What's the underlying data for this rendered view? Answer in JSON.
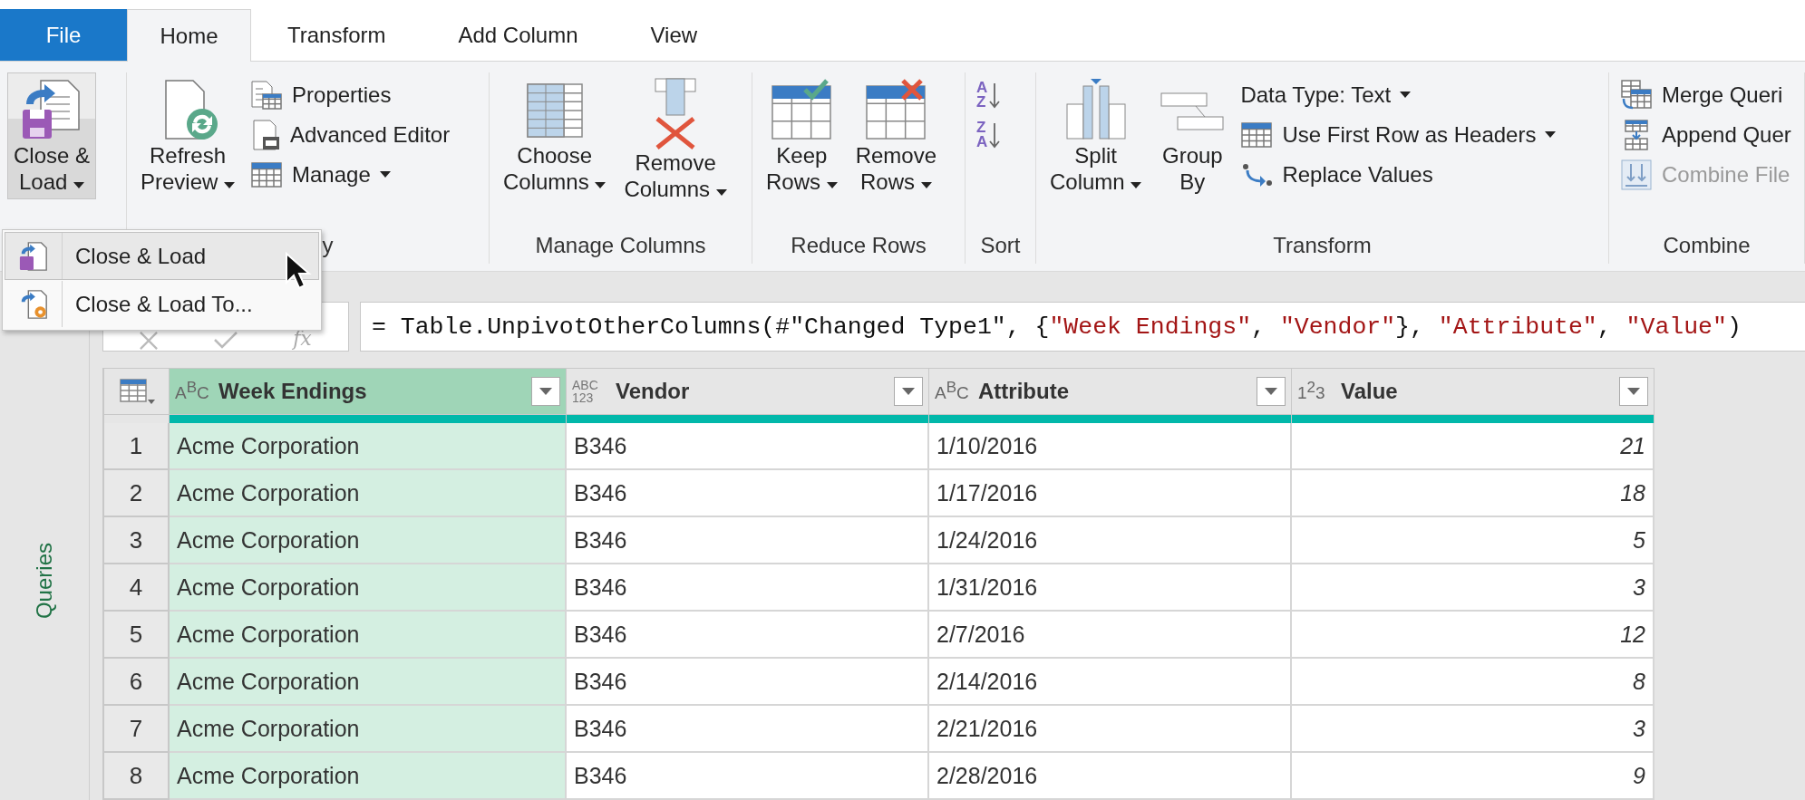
{
  "tabs": [
    {
      "label": "File",
      "kind": "file",
      "selected": false
    },
    {
      "label": "Home",
      "kind": "tab",
      "selected": true
    },
    {
      "label": "Transform",
      "kind": "tab",
      "selected": false
    },
    {
      "label": "Add Column",
      "kind": "tab",
      "selected": false
    },
    {
      "label": "View",
      "kind": "tab",
      "selected": false
    }
  ],
  "ribbon": {
    "groups": [
      {
        "items": [
          {
            "kind": "large",
            "lines": [
              "Close &",
              "Load"
            ],
            "dropdown": true,
            "pressed": true,
            "disabled": false
          }
        ]
      },
      {
        "label": "y",
        "items": [
          {
            "kind": "large",
            "lines": [
              "Refresh",
              "Preview"
            ],
            "dropdown": true,
            "pressed": false,
            "disabled": false
          },
          {
            "kind": "small",
            "label": "Properties",
            "dropdown": false,
            "pressed": false,
            "disabled": false
          },
          {
            "kind": "small",
            "label": "Advanced Editor",
            "dropdown": false,
            "pressed": false,
            "disabled": false
          },
          {
            "kind": "small",
            "label": "Manage",
            "dropdown": true,
            "pressed": false,
            "disabled": false
          }
        ]
      },
      {
        "label": "Manage Columns",
        "items": [
          {
            "kind": "large",
            "lines": [
              "Choose",
              "Columns"
            ],
            "dropdown": true,
            "pressed": false,
            "disabled": false
          },
          {
            "kind": "large",
            "lines": [
              "Remove",
              "Columns"
            ],
            "dropdown": true,
            "pressed": false,
            "disabled": false
          }
        ]
      },
      {
        "label": "Reduce Rows",
        "items": [
          {
            "kind": "large",
            "lines": [
              "Keep",
              "Rows"
            ],
            "dropdown": true,
            "pressed": false,
            "disabled": false
          },
          {
            "kind": "large",
            "lines": [
              "Remove",
              "Rows"
            ],
            "dropdown": true,
            "pressed": false,
            "disabled": false
          }
        ]
      },
      {
        "label": "Sort",
        "items": [
          {
            "kind": "sort",
            "glyph": "AZ",
            "dropdown": false,
            "pressed": false,
            "disabled": false
          },
          {
            "kind": "sort",
            "glyph": "ZA",
            "dropdown": false,
            "pressed": false,
            "disabled": false
          }
        ]
      },
      {
        "label": "Transform",
        "items": [
          {
            "kind": "large",
            "lines": [
              "Split",
              "Column"
            ],
            "dropdown": true,
            "pressed": false,
            "disabled": false
          },
          {
            "kind": "large",
            "lines": [
              "Group",
              "By"
            ],
            "dropdown": false,
            "pressed": false,
            "disabled": false
          },
          {
            "kind": "small",
            "label": "Data Type: Text",
            "dropdown": true,
            "pressed": false,
            "disabled": false
          },
          {
            "kind": "small",
            "label": "Use First Row as Headers",
            "dropdown": true,
            "pressed": false,
            "disabled": false
          },
          {
            "kind": "small",
            "label": "Replace Values",
            "dropdown": false,
            "pressed": false,
            "disabled": false
          }
        ]
      },
      {
        "label": "Combine",
        "items": [
          {
            "kind": "small",
            "label": "Merge Queri",
            "dropdown": false,
            "pressed": false,
            "disabled": false
          },
          {
            "kind": "small",
            "label": "Append Quer",
            "dropdown": false,
            "pressed": false,
            "disabled": false
          },
          {
            "kind": "small",
            "label": "Combine File",
            "dropdown": false,
            "pressed": false,
            "disabled": true
          }
        ]
      }
    ]
  },
  "dropdown_menu": {
    "items": [
      {
        "label": "Close & Load",
        "highlighted": true
      },
      {
        "label": "Close & Load To...",
        "highlighted": false
      }
    ]
  },
  "queries_pane": {
    "label": "Queries"
  },
  "formula_bar": {
    "fx_label": "fx",
    "segments": [
      {
        "kind": "code",
        "text": "= Table.UnpivotOtherColumns(#\"Changed Type1\", {"
      },
      {
        "kind": "string",
        "text": "\"Week Endings\""
      },
      {
        "kind": "code",
        "text": ", "
      },
      {
        "kind": "string",
        "text": "\"Vendor\""
      },
      {
        "kind": "code",
        "text": "}, "
      },
      {
        "kind": "string",
        "text": "\"Attribute\""
      },
      {
        "kind": "code",
        "text": ", "
      },
      {
        "kind": "string",
        "text": "\"Value\""
      },
      {
        "kind": "code",
        "text": ")"
      }
    ]
  },
  "table": {
    "columns": [
      {
        "kind": "index",
        "selected": false
      },
      {
        "name": "Week Endings",
        "kind": "text",
        "type_glyph": "A$^{B}$C",
        "selected": true
      },
      {
        "name": "Vendor",
        "kind": "any",
        "type_glyph": "ABC",
        "type_glyph2": "123",
        "selected": false
      },
      {
        "name": "Attribute",
        "kind": "text",
        "type_glyph": "A$^{B}$C",
        "selected": false
      },
      {
        "name": "Value",
        "kind": "number",
        "type_glyph": "1$^{2}$3",
        "selected": false
      }
    ],
    "rows": [
      {
        "cells": [
          "1",
          "Acme Corporation",
          "B346",
          "1/10/2016",
          "21"
        ]
      },
      {
        "cells": [
          "2",
          "Acme Corporation",
          "B346",
          "1/17/2016",
          "18"
        ]
      },
      {
        "cells": [
          "3",
          "Acme Corporation",
          "B346",
          "1/24/2016",
          "5"
        ]
      },
      {
        "cells": [
          "4",
          "Acme Corporation",
          "B346",
          "1/31/2016",
          "3"
        ]
      },
      {
        "cells": [
          "5",
          "Acme Corporation",
          "B346",
          "2/7/2016",
          "12"
        ]
      },
      {
        "cells": [
          "6",
          "Acme Corporation",
          "B346",
          "2/14/2016",
          "8"
        ]
      },
      {
        "cells": [
          "7",
          "Acme Corporation",
          "B346",
          "2/21/2016",
          "3"
        ]
      },
      {
        "cells": [
          "8",
          "Acme Corporation",
          "B346",
          "2/28/2016",
          "9"
        ]
      }
    ]
  }
}
